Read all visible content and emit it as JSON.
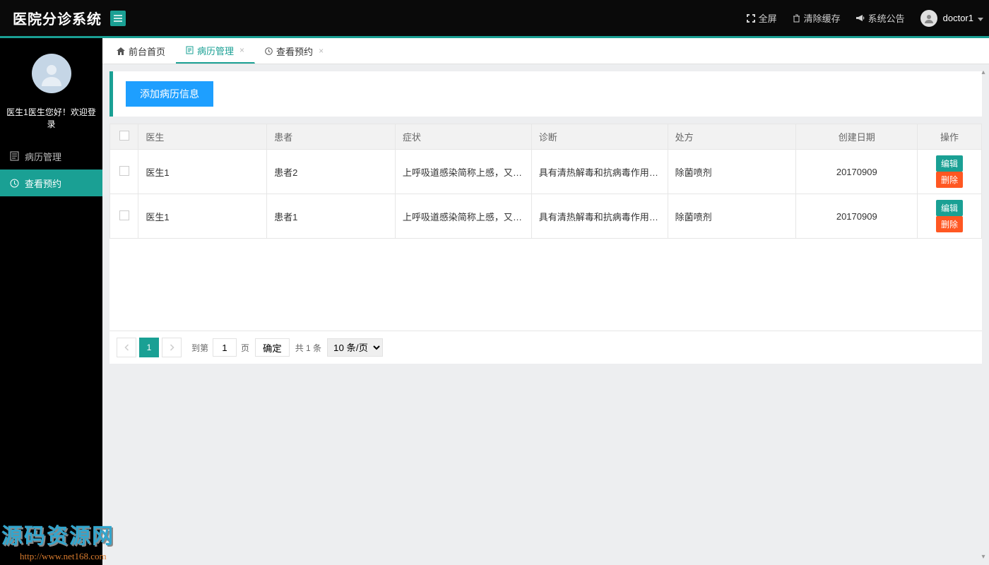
{
  "topbar": {
    "brand": "医院分诊系统",
    "fullscreen": "全屏",
    "clear_cache": "清除缓存",
    "announcement": "系统公告",
    "username": "doctor1"
  },
  "sidebar": {
    "greet": "医生1医生您好！欢迎登录",
    "items": [
      {
        "label": "病历管理",
        "active": false
      },
      {
        "label": "查看预约",
        "active": true
      }
    ]
  },
  "tabs": [
    {
      "label": "前台首页",
      "closable": false,
      "active": false,
      "icon": "home"
    },
    {
      "label": "病历管理",
      "closable": true,
      "active": true,
      "icon": "doc"
    },
    {
      "label": "查看预约",
      "closable": true,
      "active": false,
      "icon": "clock"
    }
  ],
  "actions": {
    "add_record": "添加病历信息"
  },
  "table": {
    "headers": [
      "医生",
      "患者",
      "症状",
      "诊断",
      "处方",
      "创建日期",
      "操作"
    ],
    "rows": [
      {
        "doctor": "医生1",
        "patient": "患者2",
        "symptom": "上呼吸道感染简称上感，又称普...",
        "diagnosis": "具有清热解毒和抗病毒作用的中...",
        "prescription": "除菌喷剂",
        "created": "20170909"
      },
      {
        "doctor": "医生1",
        "patient": "患者1",
        "symptom": "上呼吸道感染简称上感，又称普...",
        "diagnosis": "具有清热解毒和抗病毒作用的中...",
        "prescription": "除菌喷剂",
        "created": "20170909"
      }
    ],
    "row_actions": {
      "edit": "编辑",
      "delete": "删除"
    }
  },
  "pager": {
    "current": "1",
    "goto_prefix": "到第",
    "goto_suffix": "页",
    "go": "确定",
    "total": "共 1 条",
    "pagesize": "10 条/页",
    "page_input": "1"
  },
  "watermark": {
    "line1": "源码资源网",
    "line2": "http://www.net168.com"
  }
}
